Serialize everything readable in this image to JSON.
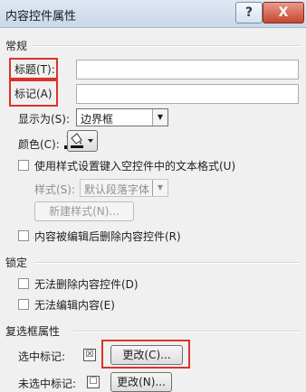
{
  "dialog": {
    "title": "内容控件属性",
    "help_label": "?",
    "close_label": "X"
  },
  "general": {
    "header": "常规",
    "title_label": "标题(T):",
    "tag_label": "标记(A)",
    "show_as_label": "显示为(S):",
    "show_as_value": "边界框",
    "color_label": "颜色(C):",
    "use_style_label": "使用样式设置键入空控件中的文本格式(U)",
    "style_label": "样式(S):",
    "style_value": "默认段落字体",
    "new_style_button": "新建样式(N)...",
    "remove_when_edited_label": "内容被编辑后删除内容控件(R)"
  },
  "locking": {
    "header": "锁定",
    "cannot_delete_label": "无法删除内容控件(D)",
    "cannot_edit_label": "无法编辑内容(E)"
  },
  "checkbox_props": {
    "header": "复选框属性",
    "checked_label": "选中标记:",
    "checked_symbol": "☒",
    "checked_change_button": "更改(C)...",
    "unchecked_label": "未选中标记:",
    "unchecked_symbol": "☐",
    "unchecked_change_button": "更改(N)..."
  },
  "colors": {
    "highlight_border": "#d9342b",
    "close_button": "#c5472e"
  }
}
